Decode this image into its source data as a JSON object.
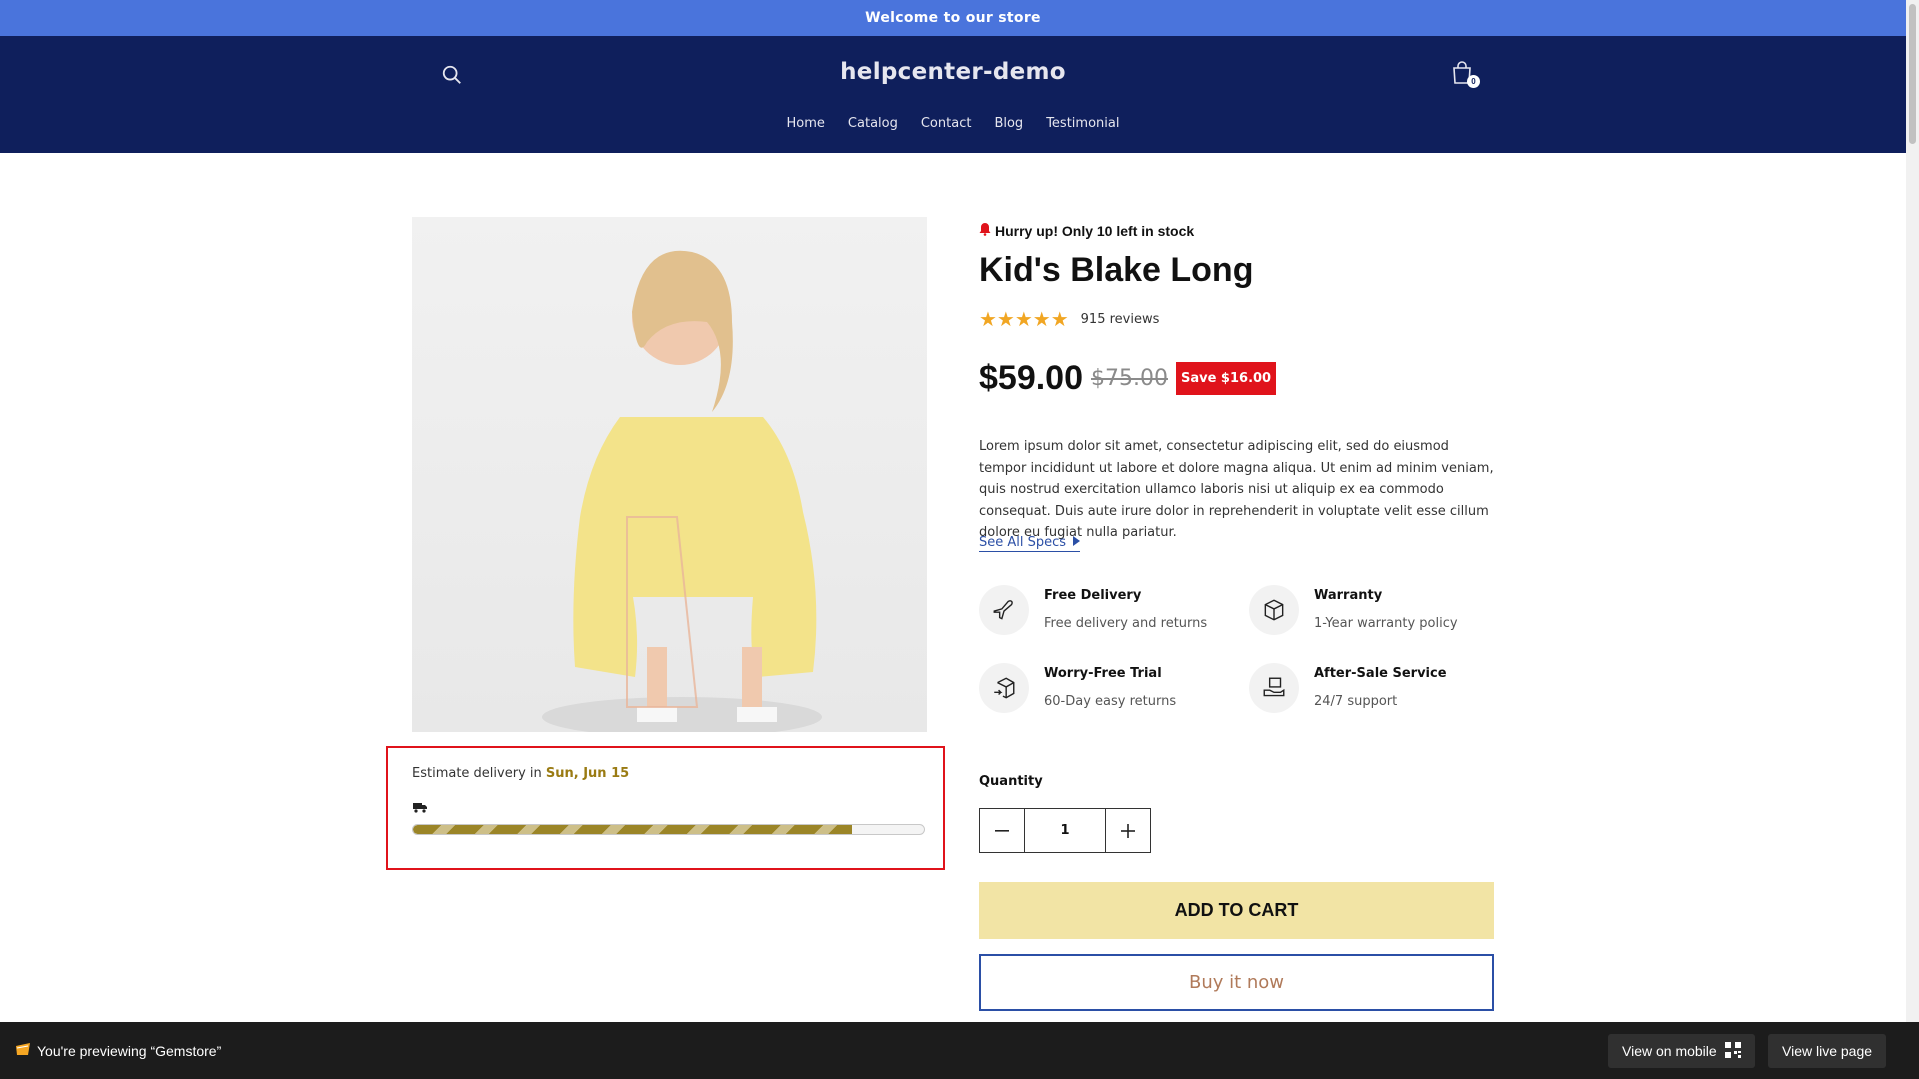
{
  "announcement": "Welcome to our store",
  "header": {
    "brand": "helpcenter-demo",
    "cart_count": "0",
    "nav": [
      "Home",
      "Catalog",
      "Contact",
      "Blog",
      "Testimonial"
    ]
  },
  "delivery": {
    "prefix": "Estimate delivery in ",
    "date": "Sun, Jun 15",
    "progress_fraction": 0.86
  },
  "product": {
    "stock_text": "Hurry up! Only 10 left in stock",
    "title": "Kid's Blake Long",
    "stars": "★★★★★",
    "reviews": "915 reviews",
    "price": "$59.00",
    "compare_price": "$75.00",
    "save_badge": "Save $16.00",
    "description": "Lorem ipsum dolor sit amet, consectetur adipiscing elit, sed do eiusmod tempor incididunt ut labore et dolore magna aliqua. Ut enim ad minim veniam, quis nostrud exercitation ullamco laboris nisi ut aliquip ex ea commodo consequat. Duis aute irure dolor in reprehenderit in voluptate velit esse cillum dolore eu fugiat nulla pariatur.",
    "see_specs": "See All Specs",
    "features": [
      {
        "title": "Free Delivery",
        "subtitle": "Free delivery and returns",
        "icon": "plane-icon"
      },
      {
        "title": "Warranty",
        "subtitle": "1-Year warranty policy",
        "icon": "box-icon"
      },
      {
        "title": "Worry-Free Trial",
        "subtitle": "60-Day easy returns",
        "icon": "return-box-icon"
      },
      {
        "title": "After-Sale Service",
        "subtitle": "24/7 support",
        "icon": "support-box-icon"
      }
    ],
    "quantity_label": "Quantity",
    "quantity_value": "1",
    "add_to_cart": "ADD TO CART",
    "buy_now": "Buy it now"
  },
  "preview_bar": {
    "text": "You're previewing “Gemstore”",
    "view_mobile": "View on mobile",
    "view_live": "View live page"
  },
  "colors": {
    "announcement_bg": "#4a74dc",
    "header_bg": "#0f1f5c",
    "accent_gold": "#9a7b13",
    "sale_red": "#e0131b",
    "add_to_cart_bg": "#f2e4a5",
    "star": "#f1a623"
  }
}
